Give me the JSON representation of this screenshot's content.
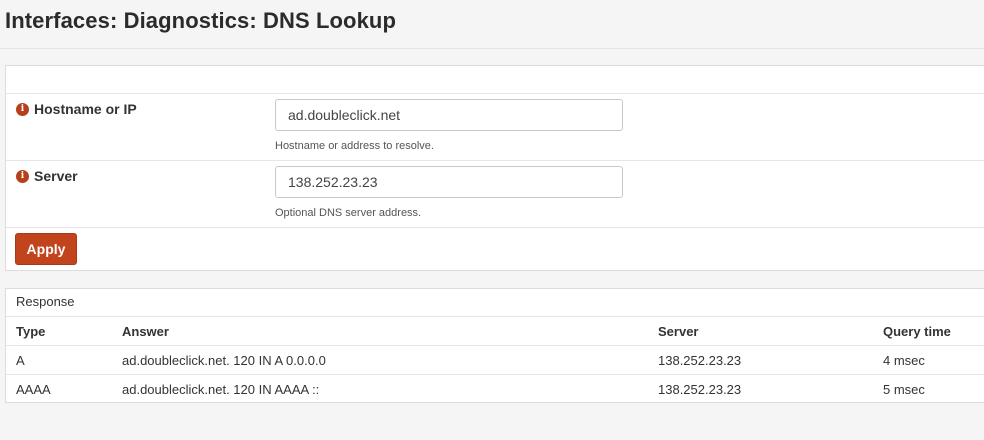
{
  "page": {
    "title": "Interfaces: Diagnostics: DNS Lookup"
  },
  "form": {
    "hostname": {
      "label": "Hostname or IP",
      "value": "ad.doubleclick.net",
      "help": "Hostname or address to resolve."
    },
    "server": {
      "label": "Server",
      "value": "138.252.23.23",
      "help": "Optional DNS server address."
    },
    "apply_label": "Apply",
    "info_icon": "i"
  },
  "response": {
    "heading": "Response",
    "columns": [
      "Type",
      "Answer",
      "Server",
      "Query time"
    ],
    "rows": [
      {
        "type": "A",
        "answer": "ad.doubleclick.net. 120 IN A 0.0.0.0",
        "server": "138.252.23.23",
        "query_time": "4 msec"
      },
      {
        "type": "AAAA",
        "answer": "ad.doubleclick.net. 120 IN AAAA ::",
        "server": "138.252.23.23",
        "query_time": "5 msec"
      }
    ]
  },
  "colors": {
    "accent": "#c1441d",
    "info_icon": "#b6401b"
  }
}
